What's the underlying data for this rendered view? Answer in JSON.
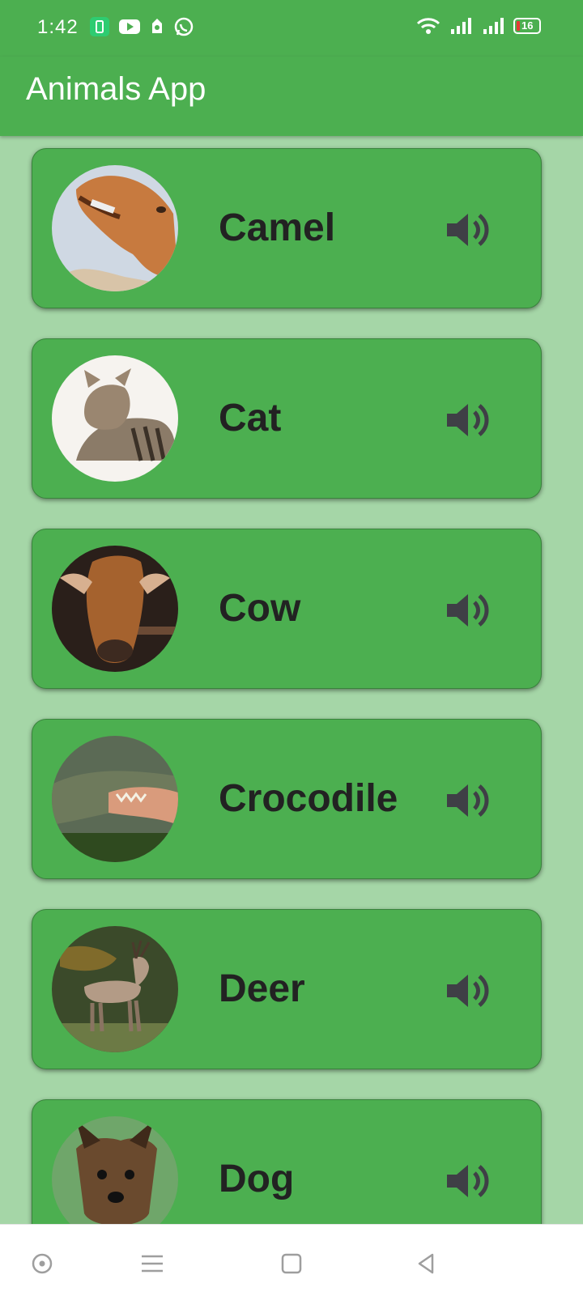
{
  "status_bar": {
    "time": "1:42",
    "battery_level": "16",
    "icons_left": [
      "battery-saver-icon",
      "youtube-icon",
      "app-icon",
      "whatsapp-icon"
    ],
    "icons_right": [
      "wifi-icon",
      "signal-icon",
      "signal-icon",
      "battery-icon"
    ]
  },
  "app_bar": {
    "title": "Animals App"
  },
  "animals": [
    {
      "name": "Camel"
    },
    {
      "name": "Cat"
    },
    {
      "name": "Cow"
    },
    {
      "name": "Crocodile"
    },
    {
      "name": "Deer"
    },
    {
      "name": "Dog"
    }
  ],
  "nav_bar": {
    "icons": [
      "recent-apps-dot-icon",
      "menu-icon",
      "home-icon",
      "back-icon"
    ]
  },
  "colors": {
    "primary": "#4caf50",
    "background": "#a5d6a7",
    "text": "#222222",
    "icon": "#3f3f46"
  }
}
